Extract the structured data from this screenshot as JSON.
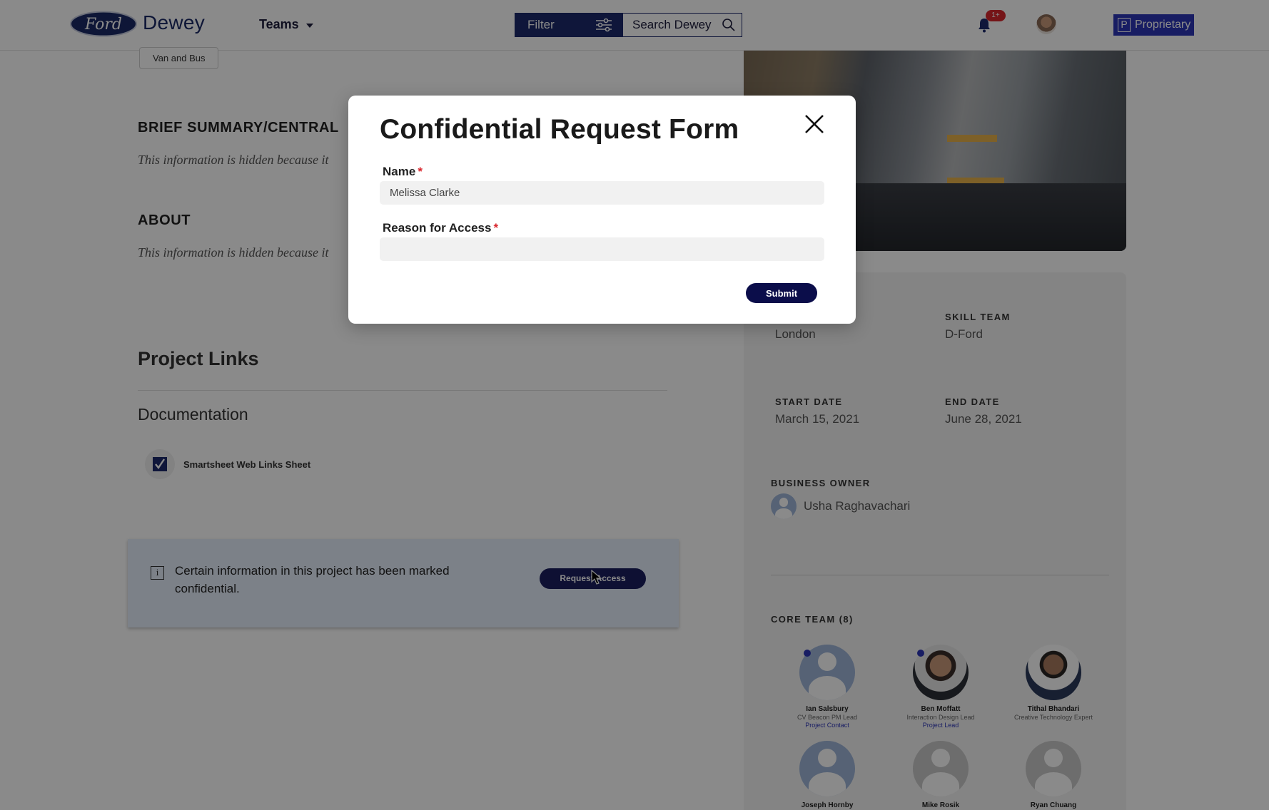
{
  "header": {
    "brand_logo_text": "Ford",
    "brand_name": "Dewey",
    "teams_label": "Teams",
    "filter_label": "Filter",
    "search_label": "Search Dewey",
    "notification_badge": "1+",
    "proprietary_letter": "P",
    "proprietary_label": "Proprietary"
  },
  "project": {
    "tag": "Van and Bus",
    "brief_heading": "BRIEF SUMMARY/CENTRAL",
    "brief_note": "This information is hidden because it",
    "about_heading": "ABOUT",
    "about_note": "This information is hidden because it",
    "links_heading": "Project Links",
    "documentation_heading": "Documentation",
    "doc_link": "Smartsheet Web Links Sheet",
    "confidential_text": "Certain information in this project has been marked confidential.",
    "request_access_label": "Request Access"
  },
  "sidebar": {
    "location_value": "London",
    "skill_team_label": "SKILL TEAM",
    "skill_team_value": "D-Ford",
    "start_date_label": "START DATE",
    "start_date_value": "March 15, 2021",
    "end_date_label": "END DATE",
    "end_date_value": "June 28, 2021",
    "business_owner_label": "BUSINESS OWNER",
    "business_owner_name": "Usha Raghavachari",
    "core_team_label": "CORE TEAM (8)",
    "core_team": [
      {
        "name": "Ian Salsbury",
        "role": "CV Beacon PM Lead",
        "tag": "Project Contact"
      },
      {
        "name": "Ben Moffatt",
        "role": "Interaction Design Lead",
        "tag": "Project Lead"
      },
      {
        "name": "Tithal Bhandari",
        "role": "Creative Technology Expert",
        "tag": ""
      },
      {
        "name": "Joseph Hornby",
        "role": "",
        "tag": ""
      },
      {
        "name": "Mike Rosik",
        "role": "",
        "tag": ""
      },
      {
        "name": "Ryan Chuang",
        "role": "",
        "tag": ""
      }
    ]
  },
  "modal": {
    "title": "Confidential Request Form",
    "name_label": "Name",
    "name_value": "Melissa Clarke",
    "reason_label": "Reason for Access",
    "reason_value": "",
    "required_mark": "*",
    "submit_label": "Submit"
  },
  "colors": {
    "brand_navy": "#1c2a6b",
    "proprietary_blue": "#2e36b8",
    "submit_navy": "#0b0d4a",
    "required_red": "#d9272e"
  }
}
